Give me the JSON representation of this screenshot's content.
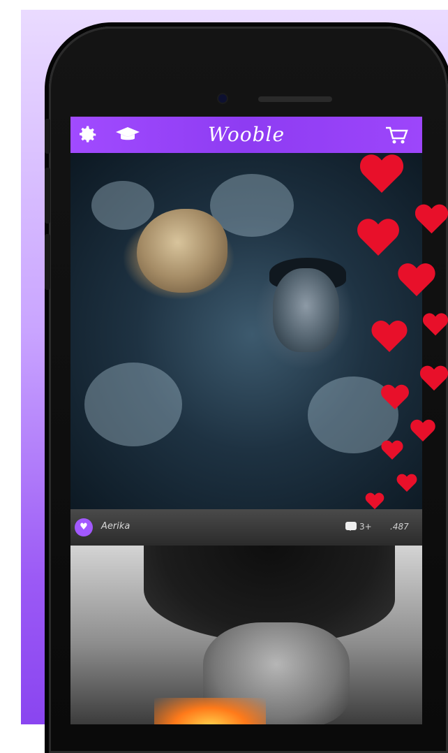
{
  "app": {
    "brand": "Wooble"
  },
  "header": {
    "icons": [
      "settings-gear-icon",
      "graduation-cap-icon",
      "cart-icon"
    ]
  },
  "post": {
    "author": "Aerika",
    "comments": "3+",
    "likes": ".487"
  },
  "colors": {
    "accent": "#9B45F8",
    "heart": "#E8102A",
    "author_bar": "#3A3A3A"
  }
}
